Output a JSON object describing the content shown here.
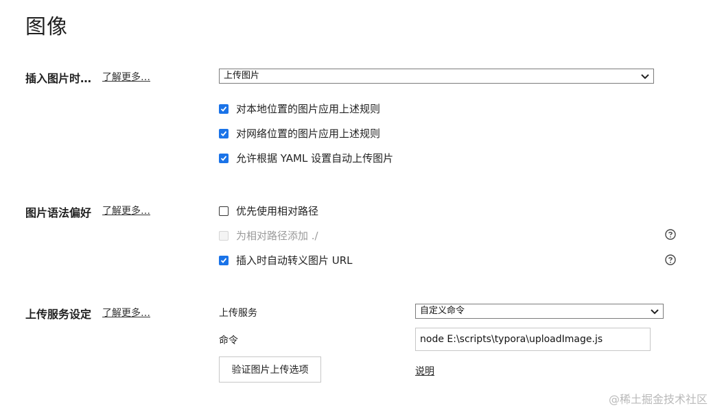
{
  "page": {
    "title": "图像"
  },
  "sections": {
    "insert": {
      "label": "插入图片时…",
      "learn_more": "了解更多…",
      "select_value": "上传图片",
      "options": [
        {
          "label": "对本地位置的图片应用上述规则",
          "checked": true
        },
        {
          "label": "对网络位置的图片应用上述规则",
          "checked": true
        },
        {
          "label": "允许根据 YAML 设置自动上传图片",
          "checked": true
        }
      ]
    },
    "syntax": {
      "label": "图片语法偏好",
      "learn_more": "了解更多…",
      "options": [
        {
          "label": "优先使用相对路径",
          "checked": false
        },
        {
          "label": "为相对路径添加 ./",
          "checked": false,
          "disabled": true
        },
        {
          "label": "插入时自动转义图片 URL",
          "checked": true
        }
      ]
    },
    "upload": {
      "label": "上传服务设定",
      "learn_more": "了解更多…",
      "service_label": "上传服务",
      "service_value": "自定义命令",
      "command_label": "命令",
      "command_value": "node E:\\scripts\\typora\\uploadImage.js",
      "verify_button": "验证图片上传选项",
      "explain_link": "说明"
    }
  },
  "watermark": "@稀土掘金技术社区",
  "colors": {
    "accent": "#1a73e8",
    "disabled": "#9a9a9a"
  },
  "icons": {
    "dropdown": "chevron-down-icon",
    "help": "help-circle-icon",
    "check": "checkmark-icon"
  }
}
